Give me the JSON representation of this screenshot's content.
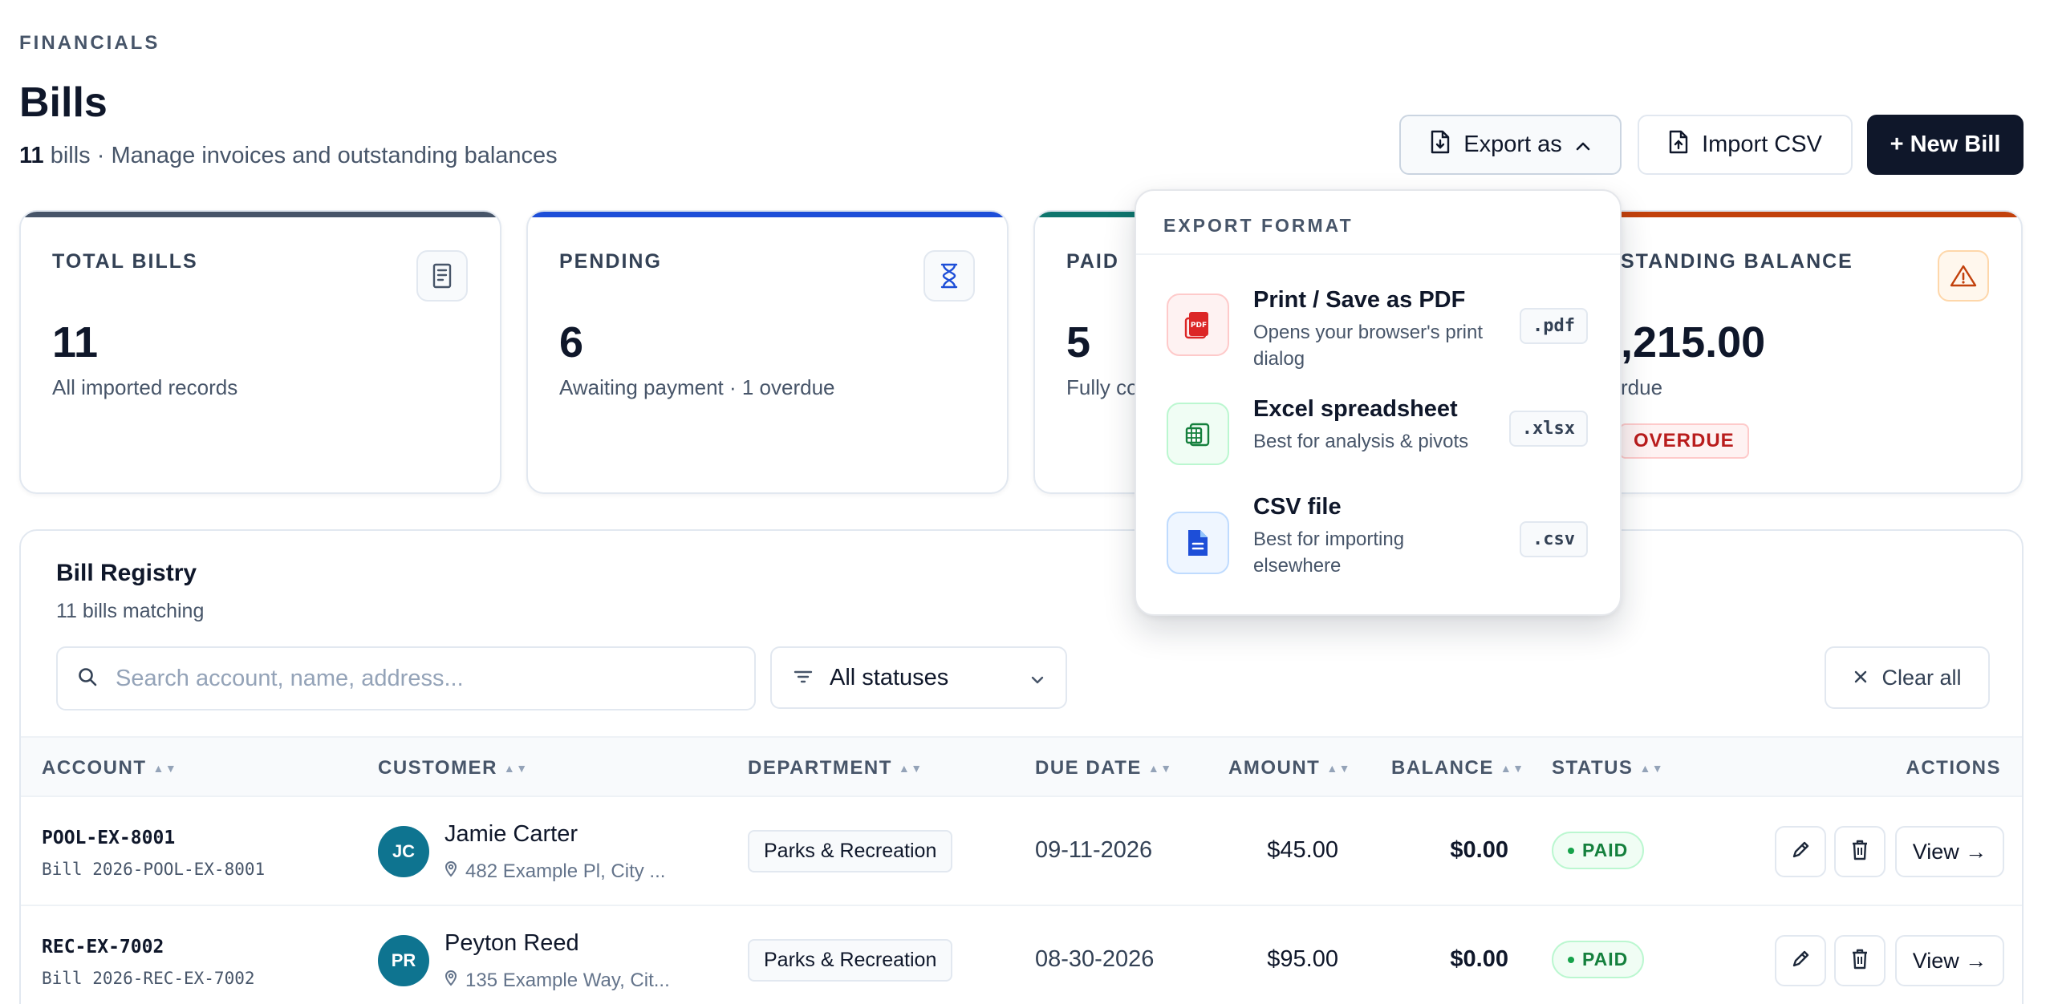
{
  "header": {
    "eyebrow": "FINANCIALS",
    "title": "Bills",
    "count": "11",
    "subtitle_rest": " bills · Manage invoices and outstanding balances"
  },
  "toolbar": {
    "export_label": "Export as",
    "import_label": "Import CSV",
    "new_label": "+ New Bill"
  },
  "cards": [
    {
      "label": "TOTAL BILLS",
      "value": "11",
      "sub": "All imported records",
      "accent": "#475569",
      "icon": "receipt-icon"
    },
    {
      "label": "PENDING",
      "value": "6",
      "sub": "Awaiting payment · 1 overdue",
      "accent": "#1d4ed8",
      "icon": "hourglass-icon"
    },
    {
      "label": "PAID",
      "value": "5",
      "sub": "Fully co",
      "accent": "#0f766e",
      "icon": "check-icon"
    },
    {
      "label": "STANDING BALANCE",
      "value": ",215.00",
      "sub": "rdue",
      "chip": "OVERDUE",
      "accent": "#c2410c",
      "icon": "warning-icon"
    }
  ],
  "registry": {
    "title": "Bill Registry",
    "subtitle": "11 bills matching",
    "search_placeholder": "Search account, name, address...",
    "status_filter": "All statuses",
    "clear_label": "Clear all",
    "columns": [
      "ACCOUNT",
      "CUSTOMER",
      "DEPARTMENT",
      "DUE DATE",
      "AMOUNT",
      "BALANCE",
      "STATUS",
      "ACTIONS"
    ],
    "rows": [
      {
        "account": "POOL-EX-8001",
        "bill": "Bill 2026-POOL-EX-8001",
        "initials": "JC",
        "name": "Jamie Carter",
        "address": "482 Example Pl, City ...",
        "department": "Parks & Recreation",
        "due": "09-11-2026",
        "amount": "$45.00",
        "balance": "$0.00",
        "status": "PAID",
        "view": "View →"
      },
      {
        "account": "REC-EX-7002",
        "bill": "Bill 2026-REC-EX-7002",
        "initials": "PR",
        "name": "Peyton Reed",
        "address": "135 Example Way, Cit...",
        "department": "Parks & Recreation",
        "due": "08-30-2026",
        "amount": "$95.00",
        "balance": "$0.00",
        "status": "PAID",
        "view": "View →"
      }
    ]
  },
  "export_menu": {
    "heading": "EXPORT FORMAT",
    "options": [
      {
        "title": "Print / Save as PDF",
        "desc": "Opens your browser's print dialog",
        "ext": ".pdf",
        "icon": "pdf-icon"
      },
      {
        "title": "Excel spreadsheet",
        "desc": "Best for analysis & pivots",
        "ext": ".xlsx",
        "icon": "spreadsheet-icon"
      },
      {
        "title": "CSV file",
        "desc": "Best for importing elsewhere",
        "ext": ".csv",
        "icon": "document-icon"
      }
    ]
  },
  "colors": {
    "primary": "#0f172a",
    "paid_green": "#15803d",
    "overdue_red": "#b91c1c",
    "pdf_red": "#dc2626",
    "excel_green": "#15803d",
    "csv_blue": "#1d4ed8"
  }
}
